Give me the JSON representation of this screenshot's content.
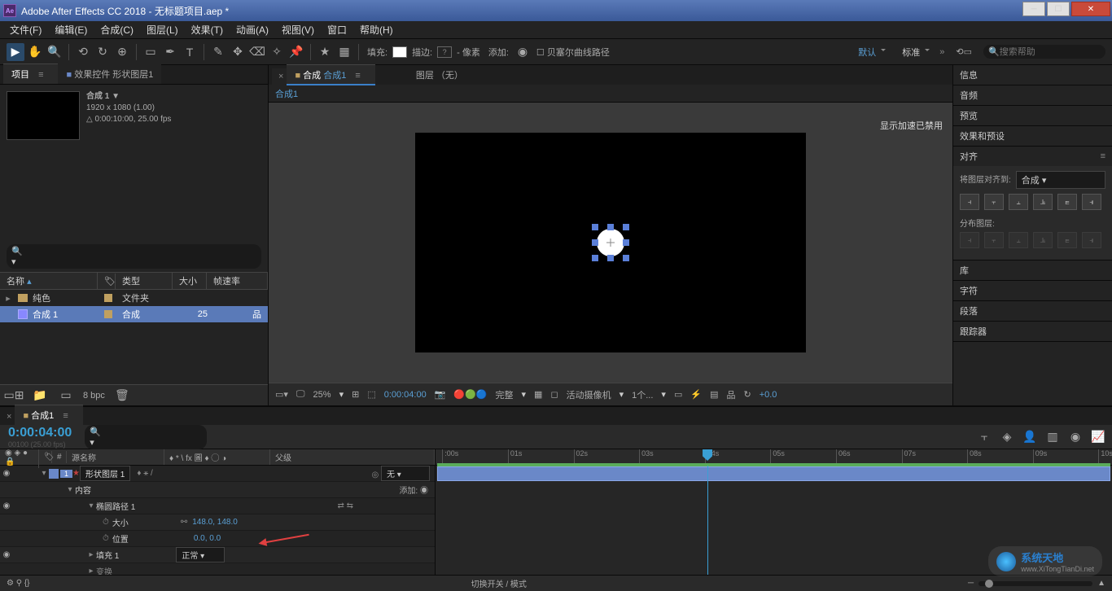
{
  "titlebar": {
    "title": "Adobe After Effects CC 2018 - 无标题项目.aep *",
    "icon_text": "Ae"
  },
  "menu": [
    "文件(F)",
    "编辑(E)",
    "合成(C)",
    "图层(L)",
    "效果(T)",
    "动画(A)",
    "视图(V)",
    "窗口",
    "帮助(H)"
  ],
  "toolbar": {
    "fill_label": "填充:",
    "stroke_label": "描边:",
    "stroke_q": "?",
    "px_label": "像素",
    "add_label": "添加:",
    "bezier_label": "贝塞尔曲线路径",
    "workspace_default": "默认",
    "workspace_std": "标准",
    "search_placeholder": "搜索帮助"
  },
  "project_panel": {
    "tab_project": "项目",
    "tab_effects": "效果控件 形状图层1",
    "comp_name": "合成 1",
    "dims": "1920 x 1080 (1.00)",
    "dur": "0:00:10:00, 25.00 fps",
    "col_name": "名称",
    "col_type": "类型",
    "col_size": "大小",
    "col_fps": "帧速率",
    "items": [
      {
        "name": "纯色",
        "type": "文件夹",
        "size": "",
        "kind": "folder"
      },
      {
        "name": "合成 1",
        "type": "合成",
        "size": "25",
        "kind": "comp",
        "selected": true
      }
    ],
    "footer_bpc": "8 bpc"
  },
  "viewer": {
    "tab_comp_prefix": "合成",
    "tab_comp_name": "合成1",
    "tab_layer": "图层 （无）",
    "sub_comp": "合成1",
    "accel_notice": "显示加速已禁用",
    "zoom": "25%",
    "timecode": "0:00:04:00",
    "quality": "完整",
    "camera": "活动摄像机",
    "views": "1个...",
    "exposure": "+0.0"
  },
  "right": {
    "panels": [
      "信息",
      "音频",
      "预览",
      "效果和预设",
      "对齐",
      "库",
      "字符",
      "段落",
      "跟踪器"
    ],
    "align": {
      "align_to_label": "将图层对齐到:",
      "align_to_value": "合成",
      "distribute_label": "分布图层:"
    }
  },
  "timeline": {
    "tab": "合成1",
    "timecode": "0:00:04:00",
    "frames": "00100 (25.00 fps)",
    "col_eye": "",
    "col_num": "#",
    "col_source": "源名称",
    "col_switches": "♦ * \\ fx 圖 ♦ ◯ ◑",
    "col_parent": "父级",
    "add_label": "添加:",
    "ruler_ticks": [
      ":00s",
      "01s",
      "02s",
      "03s",
      "04s",
      "05s",
      "06s",
      "07s",
      "08s",
      "09s",
      "10s"
    ],
    "layers": [
      {
        "num": "1",
        "name": "形状图层 1",
        "parent": "无"
      }
    ],
    "props": {
      "contents": "内容",
      "ellipse_path": "椭圆路径 1",
      "size_label": "大小",
      "size_value": "148.0, 148.0",
      "pos_label": "位置",
      "pos_value": "0.0, 0.0",
      "fill_group": "填充 1",
      "fill_mode": "正常",
      "transform_row": "变换"
    },
    "footer_label": "切换开关 / 模式"
  },
  "watermark": {
    "brand_cn": "系统天地",
    "url": "www.XiTongTianDi.net"
  }
}
